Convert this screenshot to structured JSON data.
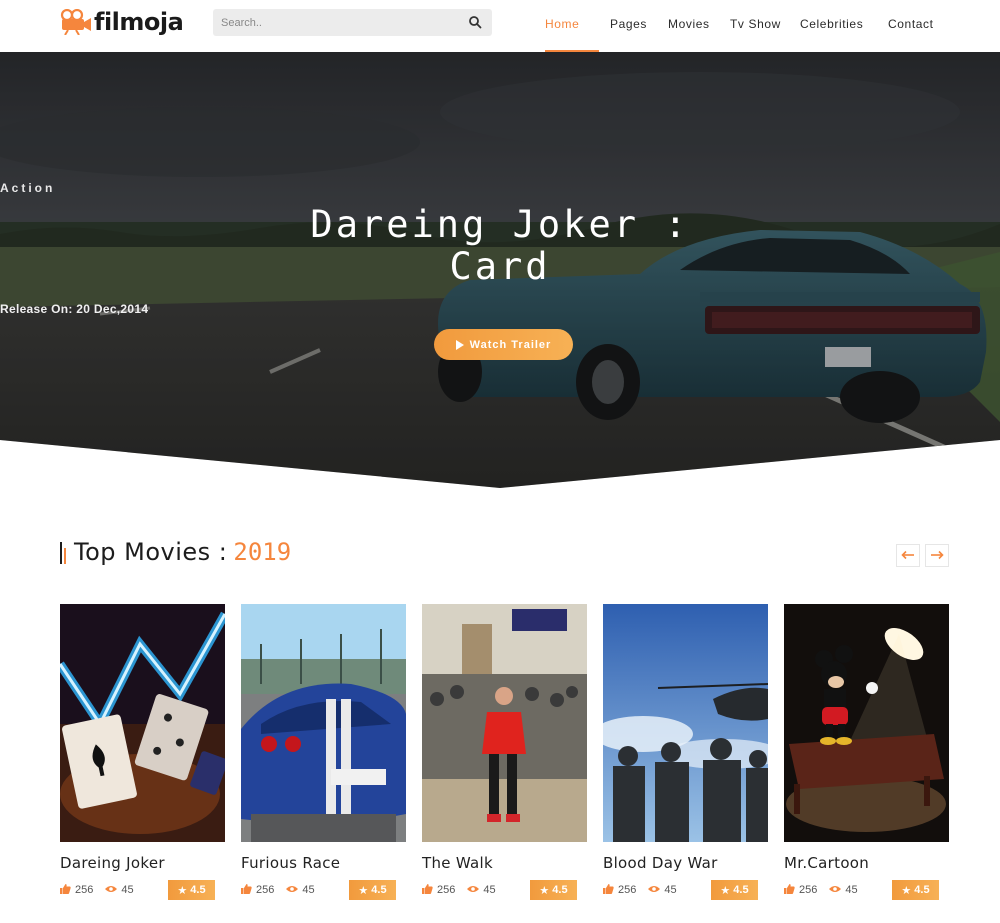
{
  "header": {
    "logo_text": "filmoja",
    "search_placeholder": "Search..",
    "nav": [
      {
        "label": "Home",
        "active": true
      },
      {
        "label": "Pages",
        "active": false
      },
      {
        "label": "Movies",
        "active": false
      },
      {
        "label": "Tv Show",
        "active": false
      },
      {
        "label": "Celebrities",
        "active": false
      },
      {
        "label": "Contact",
        "active": false
      }
    ]
  },
  "hero": {
    "genre": "Action",
    "title": "Dareing Joker : Card",
    "release": "Release On: 20 Dec,2014",
    "button_label": "Watch Trailer",
    "button_icon": "play-icon"
  },
  "section": {
    "title": "Top Movies :",
    "year": "2019",
    "prev_icon": "arrow-left-icon",
    "next_icon": "arrow-right-icon"
  },
  "movies": [
    {
      "title": "Dareing Joker",
      "likes": "256",
      "views": "45",
      "rating": "4.5"
    },
    {
      "title": "Furious Race",
      "likes": "256",
      "views": "45",
      "rating": "4.5"
    },
    {
      "title": "The Walk",
      "likes": "256",
      "views": "45",
      "rating": "4.5"
    },
    {
      "title": "Blood Day War",
      "likes": "256",
      "views": "45",
      "rating": "4.5"
    },
    {
      "title": "Mr.Cartoon",
      "likes": "256",
      "views": "45",
      "rating": "4.5"
    }
  ],
  "icons": {
    "logo": "film-camera-icon",
    "search": "search-icon",
    "likes": "thumbs-up-icon",
    "views": "eye-icon",
    "rating": "star-icon"
  },
  "colors": {
    "accent": "#f5863d",
    "accent_light": "#f7b155",
    "text_dark": "#222222"
  }
}
